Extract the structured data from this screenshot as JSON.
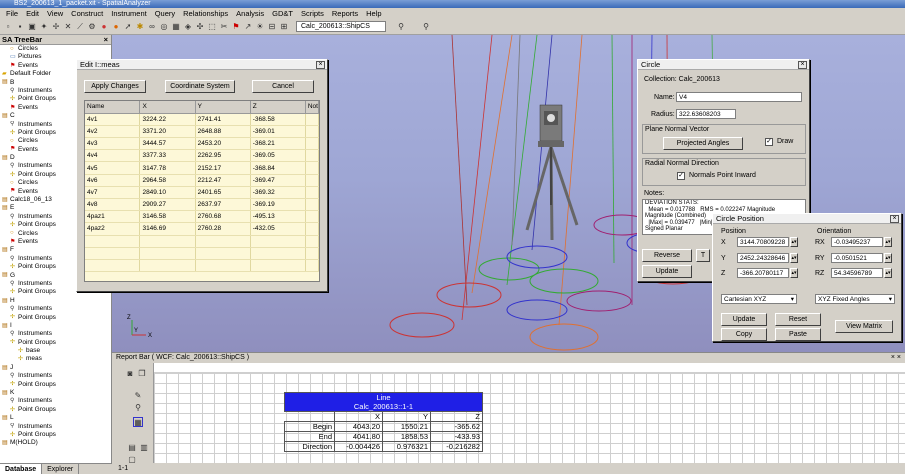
{
  "app": {
    "title": "BS2_200613_1_packet.xit - SpatialAnalyzer"
  },
  "menu": [
    "File",
    "Edit",
    "View",
    "Construct",
    "Instrument",
    "Query",
    "Relationships",
    "Analysis",
    "GD&T",
    "Scripts",
    "Reports",
    "Help"
  ],
  "toolbar": {
    "combo_value": "Calc_200613::ShipCS"
  },
  "treebar": {
    "title": "SA TreeBar",
    "items": [
      {
        "label": "Circles",
        "icon": "circle-icon",
        "indent": 1
      },
      {
        "label": "Pictures",
        "icon": "picture-icon",
        "indent": 1
      },
      {
        "label": "Events",
        "icon": "flag-icon",
        "indent": 1
      },
      {
        "label": "Default Folder",
        "icon": "folder-icon",
        "indent": 0
      },
      {
        "label": "B",
        "icon": "collection-icon",
        "indent": 0
      },
      {
        "label": "Instruments",
        "icon": "instrument-icon",
        "indent": 1
      },
      {
        "label": "Point Groups",
        "icon": "point-group-icon",
        "indent": 1
      },
      {
        "label": "Events",
        "icon": "flag-icon",
        "indent": 1
      },
      {
        "label": "C",
        "icon": "collection-icon",
        "indent": 0
      },
      {
        "label": "Instruments",
        "icon": "instrument-icon",
        "indent": 1
      },
      {
        "label": "Point Groups",
        "icon": "point-group-icon",
        "indent": 1
      },
      {
        "label": "Circles",
        "icon": "circle-icon",
        "indent": 1
      },
      {
        "label": "Events",
        "icon": "flag-icon",
        "indent": 1
      },
      {
        "label": "D",
        "icon": "collection-icon",
        "indent": 0
      },
      {
        "label": "Instruments",
        "icon": "instrument-icon",
        "indent": 1
      },
      {
        "label": "Point Groups",
        "icon": "point-group-icon",
        "indent": 1
      },
      {
        "label": "Circles",
        "icon": "circle-icon",
        "indent": 1
      },
      {
        "label": "Events",
        "icon": "flag-icon",
        "indent": 1
      },
      {
        "label": "Calc18_06_13",
        "icon": "collection-icon",
        "indent": 0
      },
      {
        "label": "E",
        "icon": "collection-icon",
        "indent": 0
      },
      {
        "label": "Instruments",
        "icon": "instrument-icon",
        "indent": 1
      },
      {
        "label": "Point Groups",
        "icon": "point-group-icon",
        "indent": 1
      },
      {
        "label": "Circles",
        "icon": "circle-icon",
        "indent": 1
      },
      {
        "label": "Events",
        "icon": "flag-icon",
        "indent": 1
      },
      {
        "label": "F",
        "icon": "collection-icon",
        "indent": 0
      },
      {
        "label": "Instruments",
        "icon": "instrument-icon",
        "indent": 1
      },
      {
        "label": "Point Groups",
        "icon": "point-group-icon",
        "indent": 1
      },
      {
        "label": "G",
        "icon": "collection-icon",
        "indent": 0
      },
      {
        "label": "Instruments",
        "icon": "instrument-icon",
        "indent": 1
      },
      {
        "label": "Point Groups",
        "icon": "point-group-icon",
        "indent": 1
      },
      {
        "label": "H",
        "icon": "collection-icon",
        "indent": 0
      },
      {
        "label": "Instruments",
        "icon": "instrument-icon",
        "indent": 1
      },
      {
        "label": "Point Groups",
        "icon": "point-group-icon",
        "indent": 1
      },
      {
        "label": "I",
        "icon": "collection-icon",
        "indent": 0
      },
      {
        "label": "Instruments",
        "icon": "instrument-icon",
        "indent": 1
      },
      {
        "label": "Point Groups",
        "icon": "point-group-icon",
        "indent": 1
      },
      {
        "label": "base",
        "icon": "point-group-icon",
        "indent": 2
      },
      {
        "label": "meas",
        "icon": "point-group-icon",
        "indent": 2
      },
      {
        "label": "J",
        "icon": "collection-icon",
        "indent": 0
      },
      {
        "label": "Instruments",
        "icon": "instrument-icon",
        "indent": 1
      },
      {
        "label": "Point Groups",
        "icon": "point-group-icon",
        "indent": 1
      },
      {
        "label": "K",
        "icon": "collection-icon",
        "indent": 0
      },
      {
        "label": "Instruments",
        "icon": "instrument-icon",
        "indent": 1
      },
      {
        "label": "Point Groups",
        "icon": "point-group-icon",
        "indent": 1
      },
      {
        "label": "L",
        "icon": "collection-icon",
        "indent": 0
      },
      {
        "label": "Instruments",
        "icon": "instrument-icon",
        "indent": 1
      },
      {
        "label": "Point Groups",
        "icon": "point-group-icon",
        "indent": 1
      },
      {
        "label": "M(HOLD)",
        "icon": "collection-icon",
        "indent": 0
      }
    ]
  },
  "edit_dialog": {
    "title": "Edit I::meas",
    "buttons": {
      "apply": "Apply Changes",
      "coord": "Coordinate System",
      "cancel": "Cancel"
    },
    "columns": [
      "Name",
      "X",
      "Y",
      "Z",
      "Not"
    ],
    "rows": [
      [
        "4v1",
        "3224.22",
        "2741.41",
        "-368.58"
      ],
      [
        "4v2",
        "3371.20",
        "2648.88",
        "-369.01"
      ],
      [
        "4v3",
        "3444.57",
        "2453.20",
        "-368.21"
      ],
      [
        "4v4",
        "3377.33",
        "2262.95",
        "-369.05"
      ],
      [
        "4v5",
        "3147.78",
        "2152.17",
        "-368.84"
      ],
      [
        "4v6",
        "2964.58",
        "2212.47",
        "-369.47"
      ],
      [
        "4v7",
        "2849.10",
        "2401.65",
        "-369.32"
      ],
      [
        "4v8",
        "2909.27",
        "2637.97",
        "-369.19"
      ],
      [
        "4paz1",
        "3146.58",
        "2760.68",
        "-495.13"
      ],
      [
        "4paz2",
        "3146.69",
        "2760.28",
        "-432.05"
      ]
    ]
  },
  "circle_dialog": {
    "title": "Circle",
    "collection_label": "Collection:",
    "collection_value": "Calc_200613",
    "name_label": "Name:",
    "name_value": "V4",
    "radius_label": "Radius:",
    "radius_value": "322.63608203",
    "plane_normal_label": "Plane Normal Vector",
    "projected_angles": "Projected Angles",
    "draw_label": "Draw",
    "radial_normal_label": "Radial Normal Direction",
    "normals_inward_label": "Normals Point Inward",
    "notes_label": "Notes:",
    "notes_lines": [
      "DEVIATION STATS:",
      "  Mean = 0.017788   RMS = 0.022247 Magnitude",
      "Magnitude (Combined)",
      "  |Max| = 0.039477   |Min| =",
      "Signed Planar"
    ],
    "reverse": "Reverse",
    "update": "Update",
    "t_btn": "T"
  },
  "circle_position": {
    "title": "Circle Position",
    "position_label": "Position",
    "orientation_label": "Orientation",
    "x_label": "X",
    "x_value": "3144.70809228",
    "y_label": "Y",
    "y_value": "2452.24328646",
    "z_label": "Z",
    "z_value": "-366.20780117",
    "rx_label": "RX",
    "rx_value": "-0.03495237",
    "ry_label": "RY",
    "ry_value": "-0.0501521",
    "rz_label": "RZ",
    "rz_value": "54.34596789",
    "pos_format": "Cartesian XYZ",
    "orient_format": "XYZ Fixed Angles",
    "update": "Update",
    "reset": "Reset",
    "copy": "Copy",
    "paste": "Paste",
    "view_matrix": "View Matrix"
  },
  "report_bar": {
    "title": "Report Bar  ( WCF: Calc_200613::ShipCS )",
    "line_title": "Line",
    "line_subtitle": "Calc_200613::1-1",
    "col_x": "X",
    "col_y": "Y",
    "col_z": "Z",
    "rows": [
      {
        "label": "Begin",
        "x": "4043.20",
        "y": "1550.21",
        "z": "-365.62"
      },
      {
        "label": "End",
        "x": "4041.80",
        "y": "1858.53",
        "z": "-433.93"
      },
      {
        "label": "Direction",
        "x": "-0.004426",
        "y": "0.976321",
        "z": "-0.216282"
      }
    ],
    "side_tab": "1-1"
  },
  "status": {
    "tab_database": "Database",
    "tab_explorer": "Explorer"
  }
}
